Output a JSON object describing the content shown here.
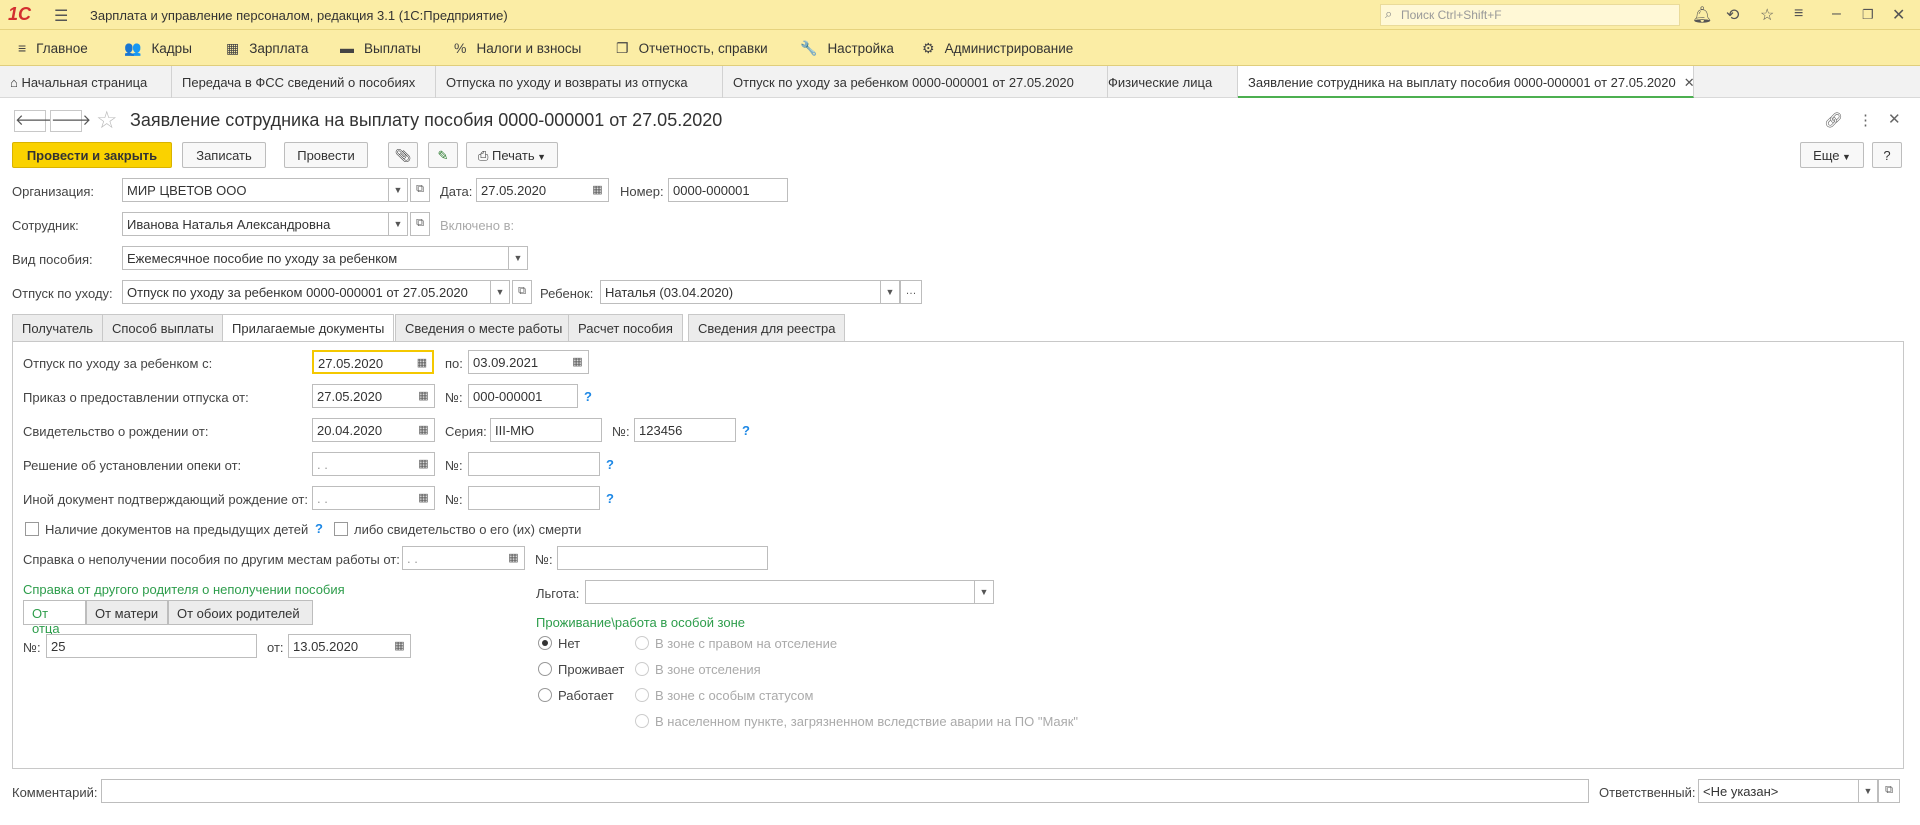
{
  "app": {
    "logo": "1С",
    "title": "Зарплата и управление персоналом, редакция 3.1  (1С:Предприятие)",
    "search_placeholder": "Поиск Ctrl+Shift+F"
  },
  "menu": [
    {
      "icon": "≡",
      "label": "Главное"
    },
    {
      "icon": "👥",
      "label": "Кадры"
    },
    {
      "icon": "▦",
      "label": "Зарплата"
    },
    {
      "icon": "▬",
      "label": "Выплаты"
    },
    {
      "icon": "%",
      "label": "Налоги и взносы"
    },
    {
      "icon": "❐",
      "label": "Отчетность, справки"
    },
    {
      "icon": "🔧",
      "label": "Настройка"
    },
    {
      "icon": "⚙",
      "label": "Администрирование"
    }
  ],
  "tabs": [
    {
      "label": "Начальная страница"
    },
    {
      "label": "Передача в ФСС сведений о пособиях"
    },
    {
      "label": "Отпуска по уходу и возвраты из отпуска"
    },
    {
      "label": "Отпуск по уходу за ребенком 0000-000001 от 27.05.2020"
    },
    {
      "label": "Физические лица"
    },
    {
      "label": "Заявление сотрудника на выплату пособия 0000-000001 от 27.05.2020"
    }
  ],
  "doc": {
    "title": "Заявление сотрудника на выплату пособия 0000-000001 от 27.05.2020"
  },
  "toolbar": {
    "post_close": "Провести и закрыть",
    "save": "Записать",
    "post": "Провести",
    "print": "Печать",
    "more": "Еще",
    "help": "?"
  },
  "header": {
    "org_label": "Организация:",
    "org_value": "МИР ЦВЕТОВ ООО",
    "date_label": "Дата:",
    "date_value": "27.05.2020",
    "number_label": "Номер:",
    "number_value": "0000-000001",
    "employee_label": "Сотрудник:",
    "employee_value": "Иванова Наталья Александровна",
    "included_label": "Включено в:",
    "benefit_label": "Вид пособия:",
    "benefit_value": "Ежемесячное пособие по уходу за ребенком",
    "leave_label": "Отпуск по уходу:",
    "leave_value": "Отпуск по уходу за ребенком 0000-000001 от 27.05.2020",
    "child_label": "Ребенок:",
    "child_value": "Наталья (03.04.2020)"
  },
  "form_tabs": [
    {
      "label": "Получатель"
    },
    {
      "label": "Способ выплаты"
    },
    {
      "label": "Прилагаемые документы"
    },
    {
      "label": "Сведения о месте работы"
    },
    {
      "label": "Расчет пособия"
    },
    {
      "label": "Сведения для реестра"
    }
  ],
  "docs": {
    "leave_from_label": "Отпуск по уходу за ребенком с:",
    "leave_from": "27.05.2020",
    "leave_to_label": "по:",
    "leave_to": "03.09.2021",
    "order_label": "Приказ о предоставлении отпуска от:",
    "order_date": "27.05.2020",
    "order_no_label": "№:",
    "order_no": "000-000001",
    "birth_label": "Свидетельство о рождении от:",
    "birth_date": "20.04.2020",
    "series_label": "Серия:",
    "series": "III-МЮ",
    "birth_no_label": "№:",
    "birth_no": "123456",
    "guardian_label": "Решение об установлении опеки от:",
    "guardian_date": " .  .",
    "guardian_no_label": "№:",
    "other_label": "Иной документ подтверждающий рождение от:",
    "other_date": " .  .",
    "other_no_label": "№:",
    "prev_children_label": "Наличие документов на предыдущих детей",
    "death_label": "либо свидетельство о его (их) смерти",
    "no_benefit_label": "Справка о неполучении пособия по другим местам работы от:",
    "no_benefit_date": " .  .",
    "no_benefit_no_label": "№:",
    "other_parent_title": "Справка от другого родителя о неполучении пособия",
    "parent_options": [
      "От отца",
      "От матери",
      "От обоих родителей"
    ],
    "parent_no_label": "№:",
    "parent_no": "25",
    "parent_date_label": "от:",
    "parent_date": "13.05.2020",
    "privilege_label": "Льгота:",
    "zone_title": "Проживание\\работа в особой зоне",
    "zone_left": [
      "Нет",
      "Проживает",
      "Работает"
    ],
    "zone_right": [
      "В зоне с правом на отселение",
      "В зоне отселения",
      "В зоне с особым статусом",
      "В населенном пункте, загрязненном вследствие аварии на ПО \"Маяк\""
    ]
  },
  "footer": {
    "comment_label": "Комментарий:",
    "responsible_label": "Ответственный:",
    "responsible_value": "<Не указан>"
  }
}
